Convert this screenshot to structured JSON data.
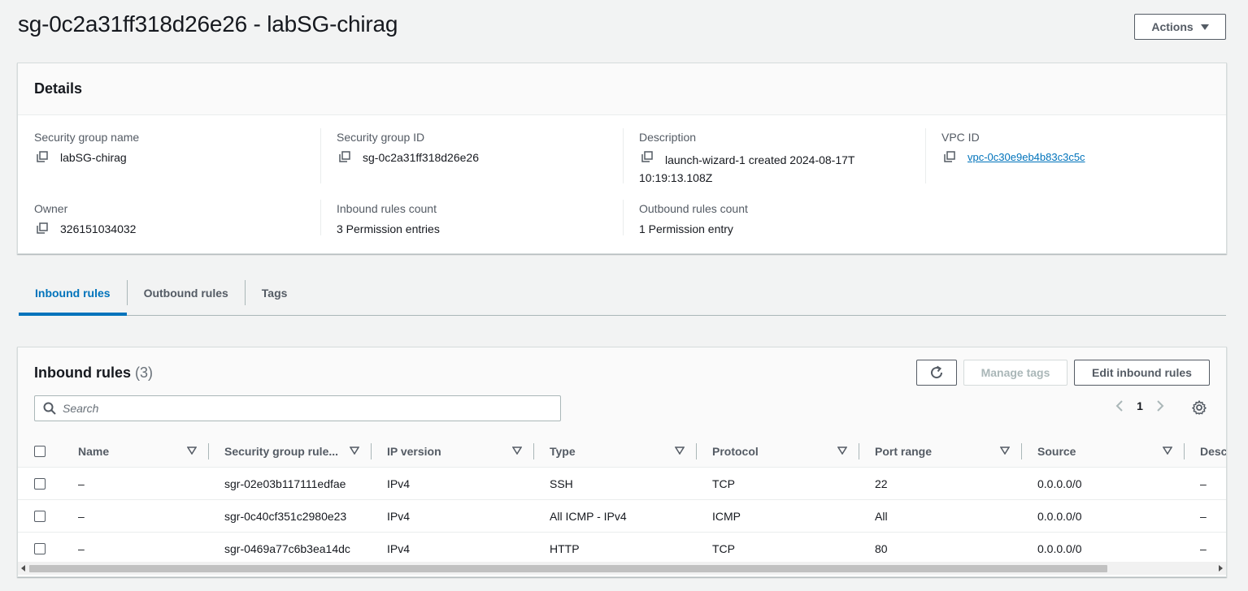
{
  "page": {
    "title": "sg-0c2a31ff318d26e26 - labSG-chirag",
    "actions_label": "Actions"
  },
  "details": {
    "heading": "Details",
    "fields": {
      "sg_name_label": "Security group name",
      "sg_name_value": "labSG-chirag",
      "sg_id_label": "Security group ID",
      "sg_id_value": "sg-0c2a31ff318d26e26",
      "description_label": "Description",
      "description_value": "launch-wizard-1 created 2024-08-17T10:19:13.108Z",
      "vpc_label": "VPC ID",
      "vpc_value": "vpc-0c30e9eb4b83c3c5c",
      "owner_label": "Owner",
      "owner_value": "326151034032",
      "inbound_count_label": "Inbound rules count",
      "inbound_count_value": "3 Permission entries",
      "outbound_count_label": "Outbound rules count",
      "outbound_count_value": "1 Permission entry"
    }
  },
  "tabs": [
    {
      "label": "Inbound rules",
      "active": true
    },
    {
      "label": "Outbound rules",
      "active": false
    },
    {
      "label": "Tags",
      "active": false
    }
  ],
  "inbound": {
    "title": "Inbound rules",
    "count": "(3)",
    "manage_tags_label": "Manage tags",
    "edit_label": "Edit inbound rules",
    "search_placeholder": "Search",
    "page": "1",
    "columns": [
      "Name",
      "Security group rule...",
      "IP version",
      "Type",
      "Protocol",
      "Port range",
      "Source",
      "Descr"
    ],
    "rows": [
      [
        "–",
        "sgr-02e03b117111edfae",
        "IPv4",
        "SSH",
        "TCP",
        "22",
        "0.0.0.0/0",
        "–"
      ],
      [
        "–",
        "sgr-0c40cf351c2980e23",
        "IPv4",
        "All ICMP - IPv4",
        "ICMP",
        "All",
        "0.0.0.0/0",
        "–"
      ],
      [
        "–",
        "sgr-0469a77c6b3ea14dc",
        "IPv4",
        "HTTP",
        "TCP",
        "80",
        "0.0.0.0/0",
        "–"
      ]
    ]
  },
  "colors": {
    "accent": "#0073bb",
    "text": "#16191f",
    "muted": "#545b64",
    "background": "#f2f3f3"
  }
}
